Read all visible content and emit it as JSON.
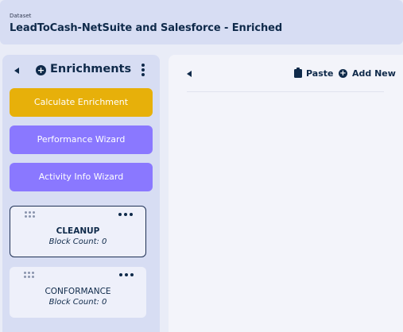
{
  "header": {
    "label": "Dataset",
    "title": "LeadToCash-NetSuite and Salesforce - Enriched"
  },
  "left_panel": {
    "title": "Enrichments",
    "icons": {
      "collapse": "triangle-left-icon",
      "add": "plus-circle-icon",
      "menu": "kebab-vertical-icon"
    },
    "buttons": {
      "calculate": "Calculate Enrichment",
      "performance": "Performance Wizard",
      "activity": "Activity Info Wizard"
    },
    "cards": [
      {
        "name": "CLEANUP",
        "count_text": "Block Count: 0",
        "selected": true
      },
      {
        "name": "CONFORMANCE",
        "count_text": "Block Count: 0",
        "selected": false
      }
    ]
  },
  "right_panel": {
    "paste_label": "Paste",
    "add_new_label": "Add New",
    "icons": {
      "back": "triangle-left-icon",
      "paste": "clipboard-icon",
      "add": "plus-circle-icon"
    }
  },
  "colors": {
    "accent_yellow": "#e7b00a",
    "accent_purple": "#8a78ff",
    "navy": "#0f2a4a",
    "panel_bg": "#d7ddf3"
  }
}
